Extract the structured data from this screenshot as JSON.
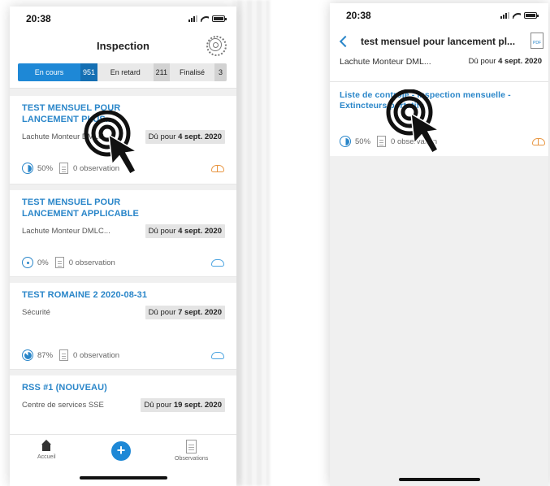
{
  "screen1": {
    "status_time": "20:38",
    "title": "Inspection",
    "tabs": [
      {
        "label": "En cours",
        "count": "951",
        "active": true
      },
      {
        "label": "En retard",
        "count": "211",
        "active": false
      },
      {
        "label": "Finalisé",
        "count": "3",
        "active": false
      }
    ],
    "cards": [
      {
        "title": "TEST MENSUEL POUR LANCEMENT PLUS...",
        "subtitle": "Lachute Monteur DMLC...",
        "due_prefix": "Dû pour",
        "due_date": "4 sept. 2020",
        "progress": "50%",
        "progress_value": 50,
        "observations": "0 observation",
        "sync": "upload"
      },
      {
        "title": "TEST MENSUEL POUR LANCEMENT APPLICABLE",
        "subtitle": "Lachute Monteur DMLC...",
        "due_prefix": "Dû pour",
        "due_date": "4 sept. 2020",
        "progress": "0%",
        "progress_value": 0,
        "observations": "0 observation",
        "sync": "cloud"
      },
      {
        "title": "TEST ROMAINE 2 2020-08-31",
        "subtitle": "Sécurité",
        "due_prefix": "Dû pour",
        "due_date": "7 sept. 2020",
        "progress": "87%",
        "progress_value": 87,
        "observations": "0 observation",
        "sync": "cloud"
      },
      {
        "title": "RSS #1 (NOUVEAU)",
        "subtitle": "Centre de services SSE",
        "due_prefix": "Dû pour",
        "due_date": "19 sept. 2020"
      }
    ],
    "tabbar": {
      "home_label": "Accueil",
      "add_label": "+",
      "observations_label": "Observations"
    }
  },
  "screen2": {
    "status_time": "20:38",
    "title": "test mensuel pour lancement pl...",
    "pdf_label": "PDF",
    "subtitle": "Lachute Monteur DML...",
    "due_prefix": "Dû pour",
    "due_date": "4 sept. 2020",
    "card": {
      "title": "Liste de contrôle - Inspection mensuelle - Extincteurs portatifs",
      "progress": "50%",
      "progress_value": 50,
      "observations": "0 observation",
      "sync": "upload"
    }
  },
  "colors": {
    "accent": "#1e88d6",
    "link": "#2a86c9",
    "upload": "#e89540",
    "cloud": "#4aa3e0"
  },
  "icons": [
    "gear-icon",
    "back-chevron-icon",
    "pdf-icon",
    "progress-icon",
    "document-icon",
    "cloud-icon",
    "cloud-upload-icon",
    "home-icon",
    "plus-icon",
    "tap-cursor-icon"
  ]
}
